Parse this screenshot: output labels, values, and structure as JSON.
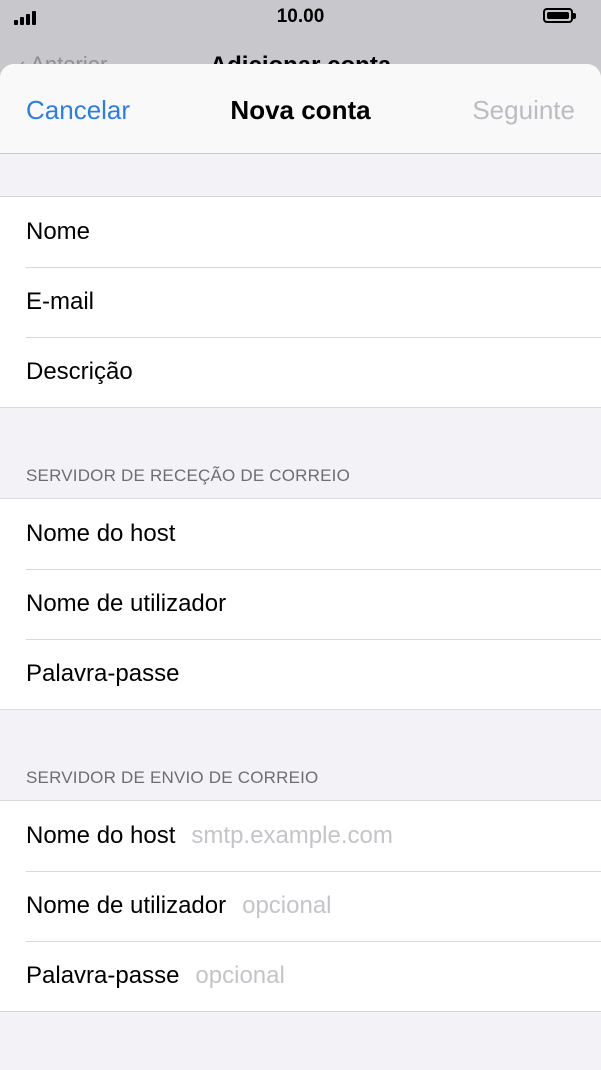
{
  "status_bar": {
    "time": "10.00"
  },
  "background_nav": {
    "back_label": "Anterior",
    "title": "Adicionar conta"
  },
  "nav": {
    "cancel_label": "Cancelar",
    "title": "Nova conta",
    "next_label": "Seguinte"
  },
  "account_fields": [
    {
      "placeholder": "Nome"
    },
    {
      "placeholder": "E-mail"
    },
    {
      "placeholder": "Descrição"
    }
  ],
  "incoming": {
    "header": "SERVIDOR DE RECEÇÃO DE CORREIO",
    "fields": [
      {
        "placeholder": "Nome do host"
      },
      {
        "placeholder": "Nome de utilizador"
      },
      {
        "placeholder": "Palavra-passe"
      }
    ]
  },
  "outgoing": {
    "header": "SERVIDOR DE ENVIO DE CORREIO",
    "fields": [
      {
        "label": "Nome do host",
        "placeholder": "smtp.example.com"
      },
      {
        "label": "Nome de utilizador",
        "placeholder": "opcional"
      },
      {
        "label": "Palavra-passe",
        "placeholder": "opcional"
      }
    ]
  },
  "colors": {
    "accent": "#2f7ed8",
    "disabled": "#bcbcc1",
    "placeholder": "#c4c4c9",
    "group_bg": "#f2f2f7"
  },
  "icons": {
    "signal": "cellular-signal-icon",
    "battery": "battery-icon",
    "back": "chevron-left-icon"
  }
}
